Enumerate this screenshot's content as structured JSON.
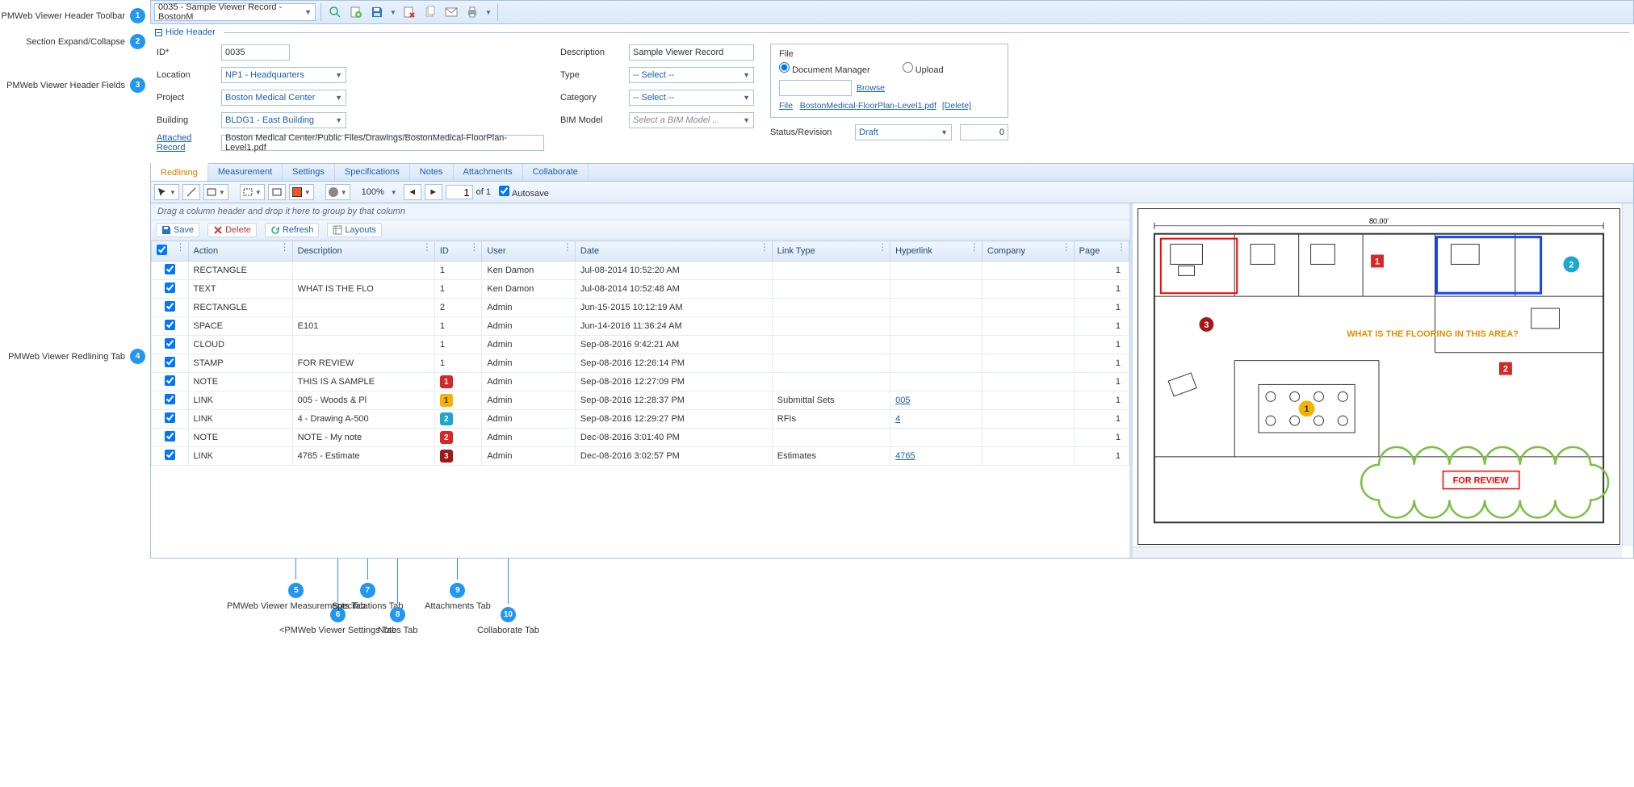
{
  "callouts": {
    "c1": "PMWeb Viewer Header Toolbar",
    "c2": "Section Expand/Collapse",
    "c3": "PMWeb Viewer Header Fields",
    "c4": "PMWeb Viewer Redlining Tab",
    "c5": "PMWeb Viewer Measurements Tab",
    "c6": "<PMWeb Viewer Settings Tab",
    "c7": "Specifications Tab",
    "c8": "Notes Tab",
    "c9": "Attachments Tab",
    "c10": "Collaborate Tab"
  },
  "toolbar": {
    "record": "0035 - Sample Viewer Record - BostonM"
  },
  "hideHeader": "Hide Header",
  "fields": {
    "id_label": "ID*",
    "id": "0035",
    "location_label": "Location",
    "location": "NP1 - Headquarters",
    "project_label": "Project",
    "project": "Boston Medical Center",
    "building_label": "Building",
    "building": "BLDG1 - East Building",
    "attached_label": "Attached Record",
    "attached": "Boston Medical Center/Public Files/Drawings/BostonMedical-FloorPlan-Level1.pdf",
    "description_label": "Description",
    "description": "Sample Viewer Record",
    "type_label": "Type",
    "type": "-- Select --",
    "category_label": "Category",
    "category": "-- Select --",
    "bim_label": "BIM Model",
    "bim": "Select a BIM Model ..."
  },
  "filebox": {
    "legend": "File",
    "docmgr": "Document Manager",
    "upload": "Upload",
    "browse": "Browse",
    "file_lbl": "File",
    "filename": "BostonMedical-FloorPlan-Level1.pdf",
    "delete": "[Delete]",
    "status_label": "Status/Revision",
    "status": "Draft",
    "rev": "0"
  },
  "tabs": {
    "redlining": "Redlining",
    "measurement": "Measurement",
    "settings": "Settings",
    "specifications": "Specifications",
    "notes": "Notes",
    "attachments": "Attachments",
    "collaborate": "Collaborate"
  },
  "rlbar": {
    "zoom": "100%",
    "page": "1",
    "of": "of  1",
    "autosave": "Autosave"
  },
  "groupbar": "Drag a column header and drop it here to group by that column",
  "gridactions": {
    "save": "Save",
    "delete": "Delete",
    "refresh": "Refresh",
    "layouts": "Layouts"
  },
  "columns": {
    "action": "Action",
    "description": "Description",
    "id": "ID",
    "user": "User",
    "date": "Date",
    "linktype": "Link Type",
    "hyperlink": "Hyperlink",
    "company": "Company",
    "page": "Page"
  },
  "rows": [
    {
      "action": "RECTANGLE",
      "desc": "",
      "id": "1",
      "user": "Ken Damon",
      "date": "Jul-08-2014 10:52:20 AM",
      "linktype": "",
      "link": "",
      "page": "1"
    },
    {
      "action": "TEXT",
      "desc": "WHAT IS THE FLO",
      "id": "1",
      "user": "Ken Damon",
      "date": "Jul-08-2014 10:52:48 AM",
      "linktype": "",
      "link": "",
      "page": "1"
    },
    {
      "action": "RECTANGLE",
      "desc": "",
      "id": "2",
      "user": "Admin",
      "date": "Jun-15-2015 10:12:19 AM",
      "linktype": "",
      "link": "",
      "page": "1"
    },
    {
      "action": "SPACE",
      "desc": "E101",
      "id": "1",
      "user": "Admin",
      "date": "Jun-14-2016 11:36:24 AM",
      "linktype": "",
      "link": "",
      "page": "1"
    },
    {
      "action": "CLOUD",
      "desc": "",
      "id": "1",
      "user": "Admin",
      "date": "Sep-08-2016 9:42:21 AM",
      "linktype": "",
      "link": "",
      "page": "1"
    },
    {
      "action": "STAMP",
      "desc": "FOR REVIEW",
      "id": "1",
      "user": "Admin",
      "date": "Sep-08-2016 12:26:14 PM",
      "linktype": "",
      "link": "",
      "page": "1"
    },
    {
      "action": "NOTE",
      "desc": "THIS IS A SAMPLE",
      "id": "1",
      "badge": "red",
      "user": "Admin",
      "date": "Sep-08-2016 12:27:09 PM",
      "linktype": "",
      "link": "",
      "page": "1"
    },
    {
      "action": "LINK",
      "desc": "005 - Woods & Pl",
      "id": "1",
      "badge": "yellow",
      "user": "Admin",
      "date": "Sep-08-2016 12:28:37 PM",
      "linktype": "Submittal Sets",
      "link": "005",
      "page": "1"
    },
    {
      "action": "LINK",
      "desc": "4 - Drawing A-500",
      "id": "2",
      "badge": "cyan",
      "user": "Admin",
      "date": "Sep-08-2016 12:29:27 PM",
      "linktype": "RFIs",
      "link": "4",
      "page": "1"
    },
    {
      "action": "NOTE",
      "desc": "NOTE - My note",
      "id": "2",
      "badge": "red",
      "user": "Admin",
      "date": "Dec-08-2016 3:01:40 PM",
      "linktype": "",
      "link": "",
      "page": "1"
    },
    {
      "action": "LINK",
      "desc": "4765 - Estimate",
      "id": "3",
      "badge": "darkred",
      "user": "Admin",
      "date": "Dec-08-2016 3:02:57 PM",
      "linktype": "Estimates",
      "link": "4765",
      "page": "1"
    }
  ],
  "plan": {
    "dim": "80.00'",
    "question": "WHAT IS THE FLOORING IN THIS AREA?",
    "stamp": "FOR REVIEW"
  }
}
